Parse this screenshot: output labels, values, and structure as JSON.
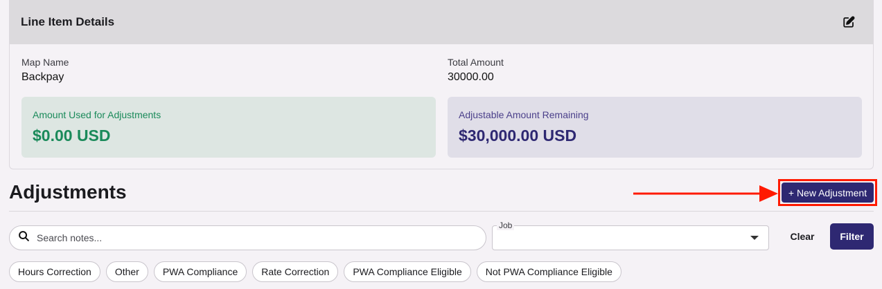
{
  "line_item": {
    "title": "Line Item Details",
    "map_name_label": "Map Name",
    "map_name_value": "Backpay",
    "total_amount_label": "Total Amount",
    "total_amount_value": "30000.00",
    "used_label": "Amount Used for Adjustments",
    "used_value": "$0.00 USD",
    "remaining_label": "Adjustable Amount Remaining",
    "remaining_value": "$30,000.00 USD"
  },
  "adjustments": {
    "title": "Adjustments",
    "new_button": "+ New Adjustment",
    "search_placeholder": "Search notes...",
    "job_label": "Job",
    "clear_button": "Clear",
    "filter_button": "Filter",
    "chips": [
      "Hours Correction",
      "Other",
      "PWA Compliance",
      "Rate Correction",
      "PWA Compliance Eligible",
      "Not PWA Compliance Eligible"
    ]
  },
  "colors": {
    "accent": "#2e2872",
    "success": "#1a8a5a",
    "annotation": "#ff1a00"
  },
  "icons": {
    "edit": "edit-icon",
    "search": "search-icon",
    "dropdown": "chevron-down-icon",
    "arrow": "arrow-right-icon"
  }
}
